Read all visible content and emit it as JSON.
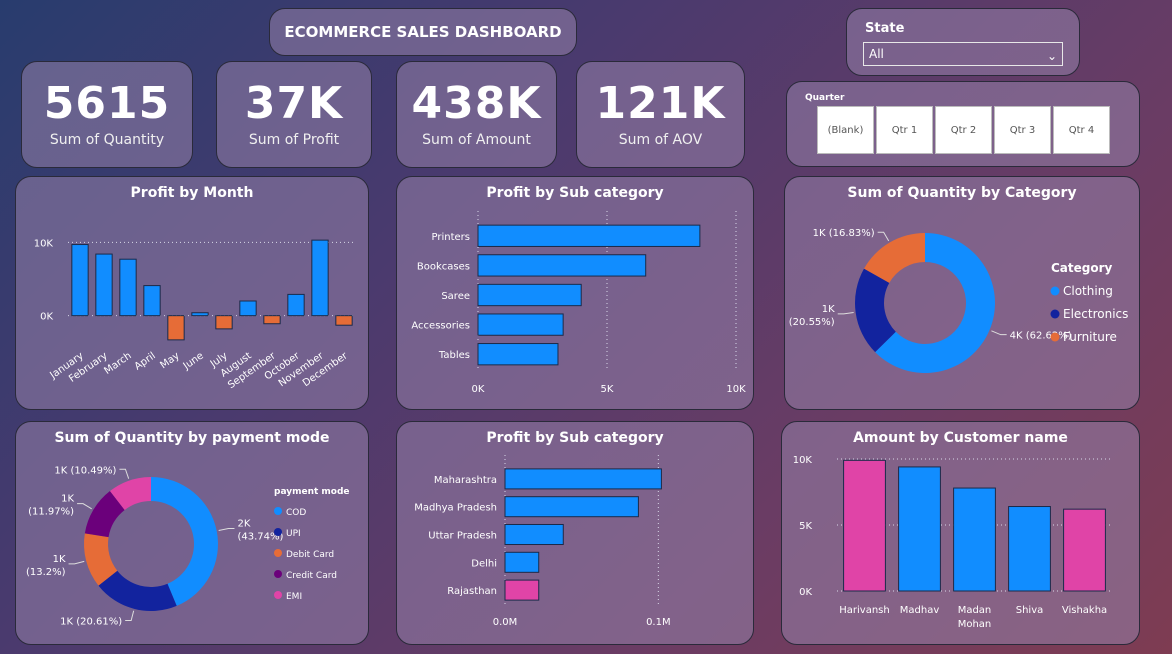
{
  "header": {
    "title": "ECOMMERCE SALES DASHBOARD"
  },
  "kpis": [
    {
      "value": "5615",
      "label": "Sum of Quantity"
    },
    {
      "value": "37K",
      "label": "Sum of Profit"
    },
    {
      "value": "438K",
      "label": "Sum of Amount"
    },
    {
      "value": "121K",
      "label": "Sum of AOV"
    }
  ],
  "filters": {
    "state": {
      "label": "State",
      "selected": "All"
    },
    "quarter": {
      "label": "Quarter",
      "options": [
        "(Blank)",
        "Qtr 1",
        "Qtr 2",
        "Qtr 3",
        "Qtr 4"
      ]
    }
  },
  "colors": {
    "blue": "#118DFF",
    "navy": "#12239E",
    "orange": "#E66C37",
    "purple": "#6B007B",
    "pink": "#E044A7"
  },
  "chart_data": [
    {
      "id": "profit_by_month",
      "type": "bar",
      "title": "Profit by Month",
      "categories": [
        "January",
        "February",
        "March",
        "April",
        "May",
        "June",
        "July",
        "August",
        "September",
        "October",
        "November",
        "December"
      ],
      "values": [
        9700,
        8400,
        7700,
        4100,
        -3300,
        400,
        -1800,
        2000,
        -1100,
        2900,
        10300,
        -1300
      ],
      "ylim": [
        -4000,
        11000
      ],
      "yticks": [
        {
          "v": 0,
          "label": "0K"
        },
        {
          "v": 10000,
          "label": "10K"
        }
      ],
      "positive_color": "#118DFF",
      "negative_color": "#E66C37"
    },
    {
      "id": "profit_by_subcategory",
      "type": "bar",
      "orientation": "horizontal",
      "title": "Profit by Sub category",
      "categories": [
        "Printers",
        "Bookcases",
        "Saree",
        "Accessories",
        "Tables"
      ],
      "values": [
        8600,
        6500,
        4000,
        3300,
        3100
      ],
      "xlim": [
        0,
        10000
      ],
      "xticks": [
        {
          "v": 0,
          "label": "0K"
        },
        {
          "v": 5000,
          "label": "5K"
        },
        {
          "v": 10000,
          "label": "10K"
        }
      ]
    },
    {
      "id": "quantity_by_category",
      "type": "pie",
      "donut": true,
      "title": "Sum of Quantity by Category",
      "legend_title": "Category",
      "legend_position": "right",
      "slices": [
        {
          "name": "Clothing",
          "value": 62.62,
          "label": "4K (62.62%)",
          "color": "#118DFF"
        },
        {
          "name": "Electronics",
          "value": 20.55,
          "label": "1K (20.55%)",
          "color": "#12239E"
        },
        {
          "name": "Furniture",
          "value": 16.83,
          "label": "1K (16.83%)",
          "color": "#E66C37"
        }
      ]
    },
    {
      "id": "quantity_by_payment_mode",
      "type": "pie",
      "donut": true,
      "title": "Sum of Quantity by payment mode",
      "legend_title": "payment mode",
      "legend_position": "right",
      "slices": [
        {
          "name": "COD",
          "value": 43.74,
          "label": "2K (43.74%)",
          "color": "#118DFF"
        },
        {
          "name": "UPI",
          "value": 20.61,
          "label": "1K (20.61%)",
          "color": "#12239E"
        },
        {
          "name": "Debit Card",
          "value": 13.2,
          "label": "1K (13.2%)",
          "color": "#E66C37"
        },
        {
          "name": "Credit Card",
          "value": 11.97,
          "label": "1K (11.97%)",
          "color": "#6B007B"
        },
        {
          "name": "EMI",
          "value": 10.49,
          "label": "1K (10.49%)",
          "color": "#E044A7"
        }
      ]
    },
    {
      "id": "profit_by_state",
      "type": "bar",
      "orientation": "horizontal",
      "title": "Profit by Sub category",
      "categories": [
        "Maharashtra",
        "Madhya Pradesh",
        "Uttar Pradesh",
        "Delhi",
        "Rajasthan"
      ],
      "values": [
        102000,
        87000,
        38000,
        22000,
        22000
      ],
      "colors": [
        "#118DFF",
        "#118DFF",
        "#118DFF",
        "#118DFF",
        "#E044A7"
      ],
      "xlim": [
        0,
        150000
      ],
      "xticks": [
        {
          "v": 0,
          "label": "0.0M"
        },
        {
          "v": 100000,
          "label": "0.1M"
        }
      ]
    },
    {
      "id": "amount_by_customer",
      "type": "bar",
      "title": "Amount by Customer name",
      "categories": [
        "Harivansh",
        "Madhav",
        "Madan Mohan",
        "Shiva",
        "Vishakha"
      ],
      "values": [
        9900,
        9400,
        7800,
        6400,
        6200
      ],
      "colors": [
        "#E044A7",
        "#118DFF",
        "#118DFF",
        "#118DFF",
        "#E044A7"
      ],
      "ylim": [
        0,
        10000
      ],
      "yticks": [
        {
          "v": 0,
          "label": "0K"
        },
        {
          "v": 5000,
          "label": "5K"
        },
        {
          "v": 10000,
          "label": "10K"
        }
      ]
    }
  ]
}
